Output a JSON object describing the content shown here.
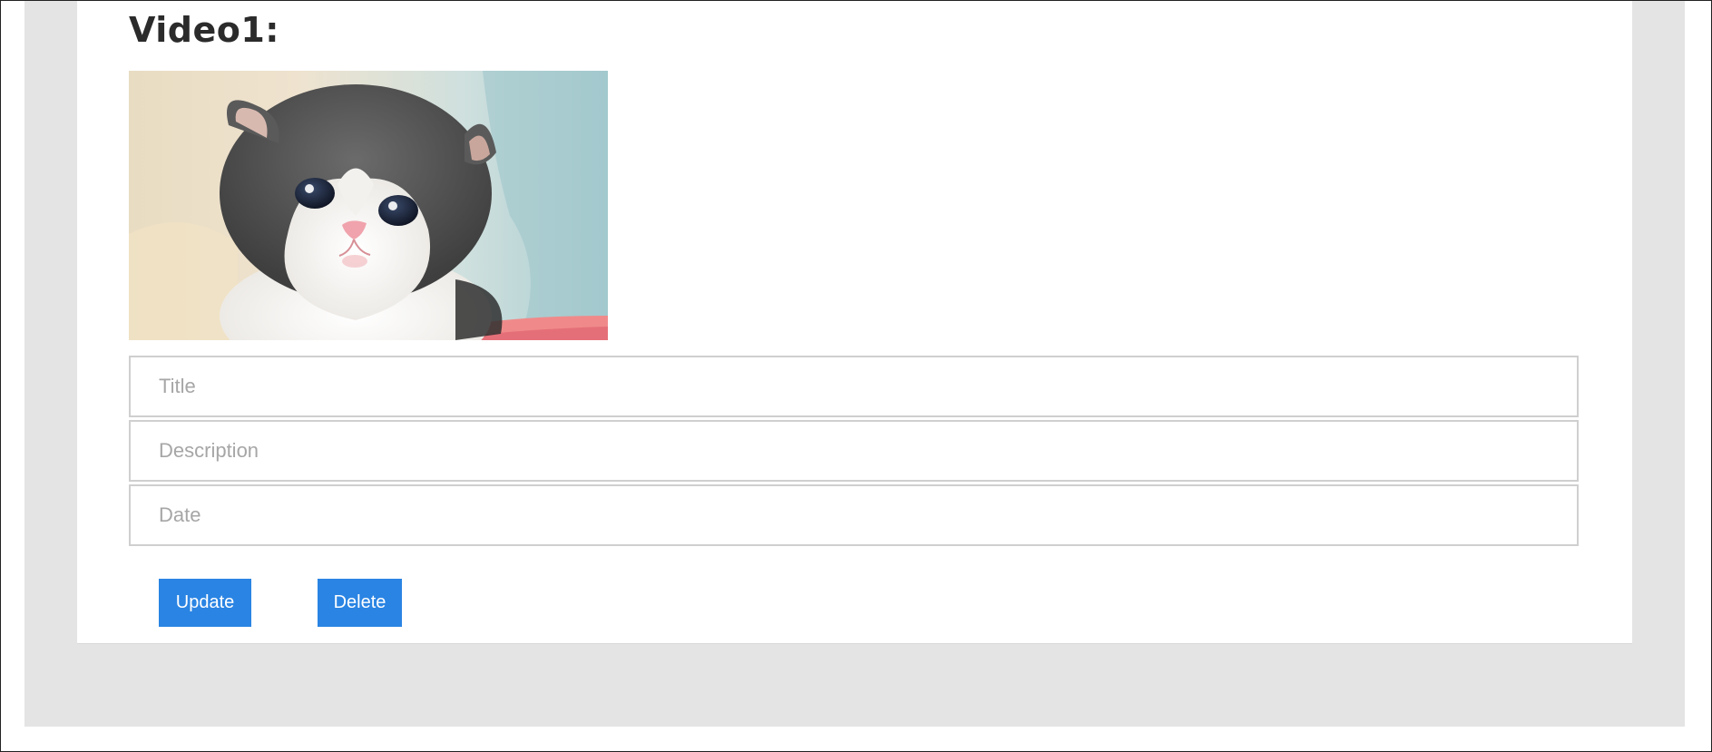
{
  "video": {
    "heading": "Video1:",
    "thumbnail": "kitten-thumbnail"
  },
  "form": {
    "title_placeholder": "Title",
    "title_value": "",
    "description_placeholder": "Description",
    "description_value": "",
    "date_placeholder": "Date",
    "date_value": ""
  },
  "actions": {
    "update_label": "Update",
    "delete_label": "Delete"
  },
  "colors": {
    "button": "#2a84e3",
    "page_background": "#e4e4e4",
    "card_background": "#ffffff",
    "input_border": "#cfcfcf",
    "placeholder_text": "#a6a6a6",
    "heading_text": "#2b2b2b"
  }
}
